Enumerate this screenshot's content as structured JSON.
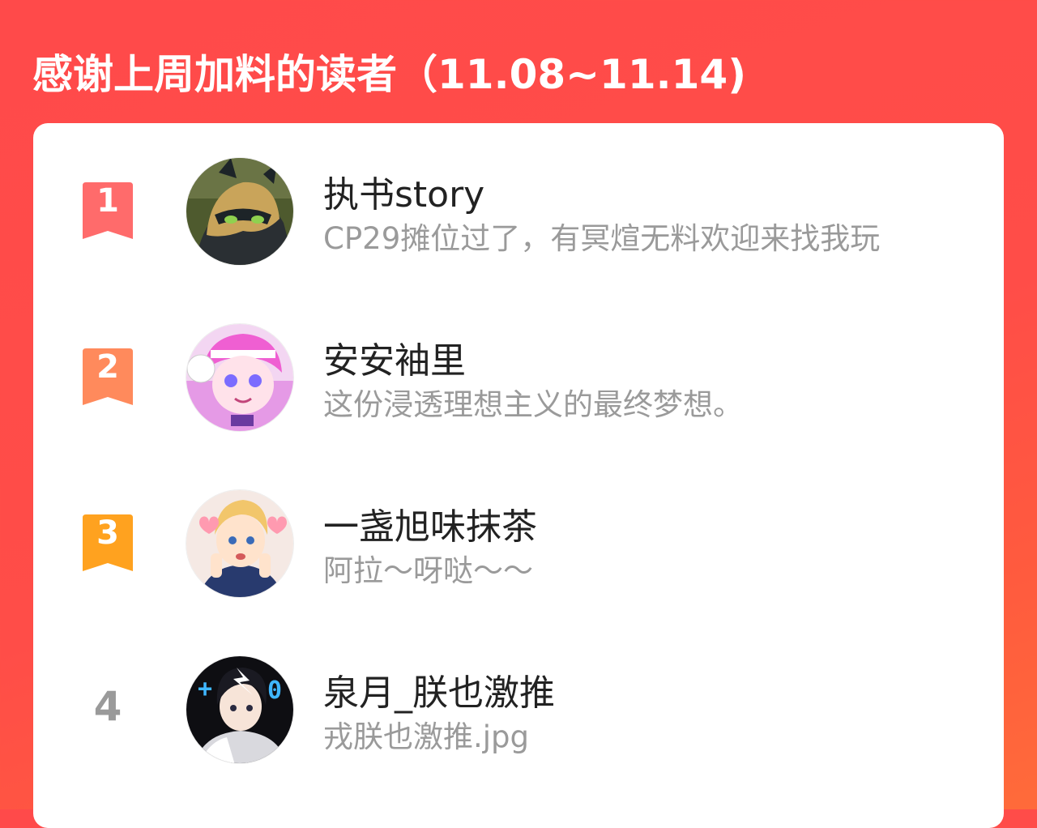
{
  "header": {
    "title": "感谢上周加料的读者（11.08~11.14)"
  },
  "colors": {
    "background": "#ff4a4a",
    "rank1": "#ff6b6b",
    "rank2": "#ff8a5c",
    "rank3": "#ffa21f",
    "rank_plain": "#9a9a9a",
    "name": "#222222",
    "message": "#9a9a9a"
  },
  "readers": [
    {
      "rank": "1",
      "name": "执书story",
      "message": "CP29摊位过了，有冥煊无料欢迎来找我玩",
      "avatar_icon": "cartoon-cat-hero-avatar"
    },
    {
      "rank": "2",
      "name": "安安袖里",
      "message": "这份浸透理想主义的最终梦想。",
      "avatar_icon": "pink-hair-anime-avatar"
    },
    {
      "rank": "3",
      "name": "一盏旭味抹茶",
      "message": "阿拉～呀哒～～",
      "avatar_icon": "blonde-anime-boy-avatar"
    },
    {
      "rank": "4",
      "name": "泉月_朕也激推",
      "message": "戎朕也激推.jpg",
      "avatar_icon": "dark-hair-anime-boy-avatar"
    }
  ]
}
